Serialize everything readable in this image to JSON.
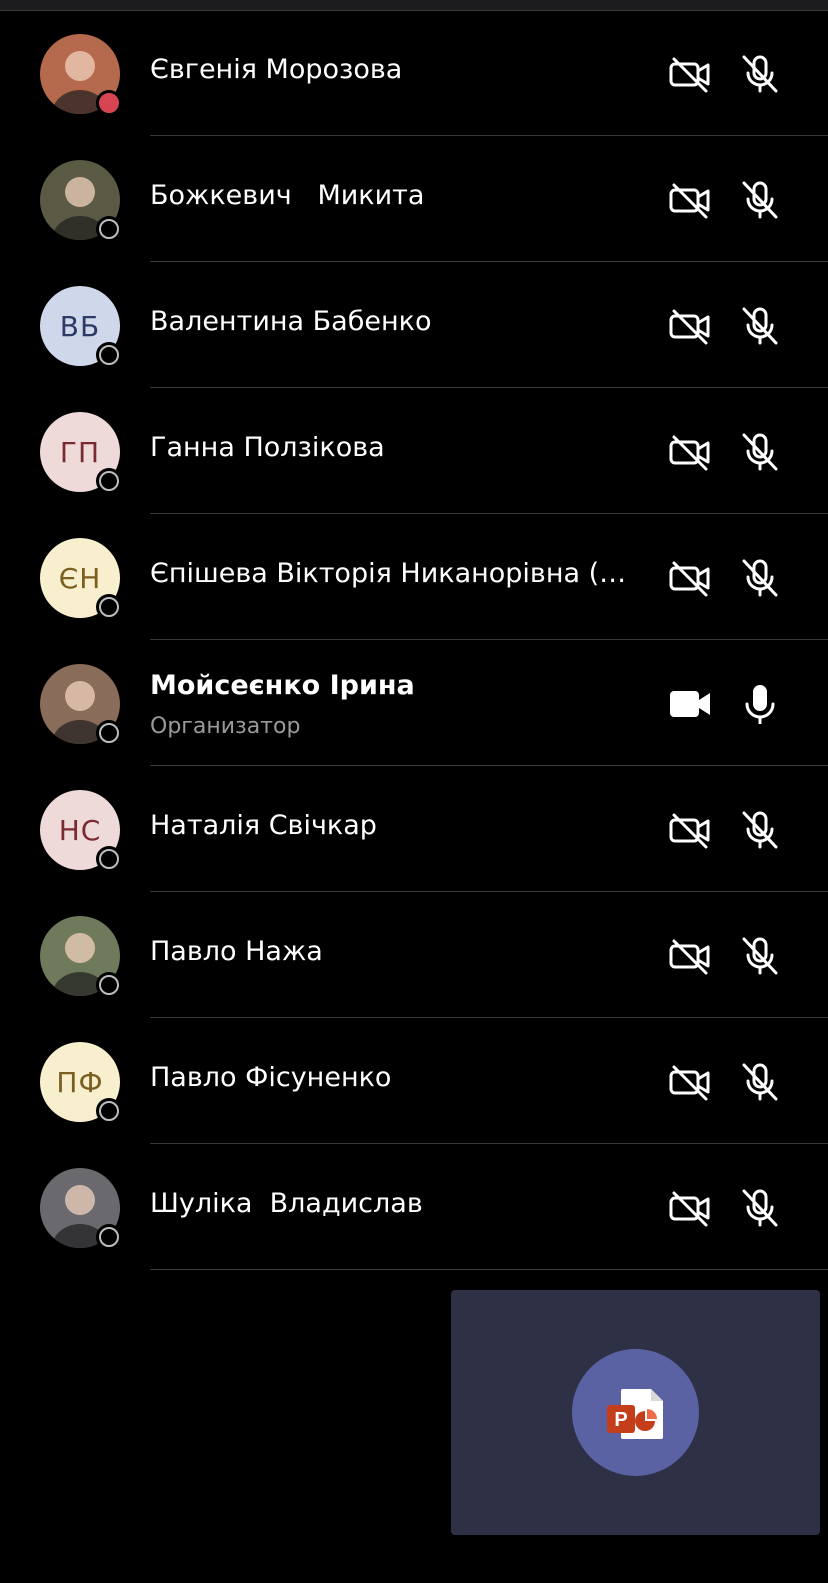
{
  "participants": [
    {
      "name": "Євгенія Морозова",
      "avatar_type": "photo",
      "photo_tone": "#b56a4d",
      "status": "busy"
    },
    {
      "name": "Божкевич   Микита",
      "avatar_type": "photo",
      "photo_tone": "#5b5a45",
      "status": "offline"
    },
    {
      "name": "Валентина Бабенко",
      "avatar_type": "initials",
      "initials": "ВБ",
      "bg": "#cfd8ea",
      "fg": "#2c3b66",
      "status": "offline"
    },
    {
      "name": "Ганна Ползікова",
      "avatar_type": "initials",
      "initials": "ГП",
      "bg": "#efdada",
      "fg": "#7a2b32",
      "status": "offline"
    },
    {
      "name": "Єпішева Вікторія Никанорівна (г...",
      "avatar_type": "initials",
      "initials": "ЄН",
      "bg": "#f7efcd",
      "fg": "#7a5f20",
      "status": "offline"
    },
    {
      "name": "Мойсеєнко Ірина",
      "role": "Организатор",
      "avatar_type": "photo",
      "photo_tone": "#8a6c5a",
      "status": "offline",
      "camera_on": true,
      "mic_on": true
    },
    {
      "name": "Наталія Свічкар",
      "avatar_type": "initials",
      "initials": "НС",
      "bg": "#efdada",
      "fg": "#7a2b32",
      "status": "offline"
    },
    {
      "name": "Павло Нажа",
      "avatar_type": "photo",
      "photo_tone": "#6f7a5c",
      "status": "offline"
    },
    {
      "name": "Павло Фісуненко",
      "avatar_type": "initials",
      "initials": "ПФ",
      "bg": "#f7efcd",
      "fg": "#7a5f20",
      "status": "offline"
    },
    {
      "name": "Шуліка  Владислав",
      "avatar_type": "photo",
      "photo_tone": "#6a6a6e",
      "status": "offline"
    }
  ],
  "colors": {
    "background": "#000000",
    "separator": "#38383a",
    "busy": "#d74553",
    "share_tile": "#2e3046",
    "powerpoint_button": "#5b62a3",
    "powerpoint_brand": "#c43e1c"
  },
  "icons": {
    "camera_off": "camera-off-icon",
    "mic_off": "mic-off-icon",
    "camera_on": "camera-icon",
    "mic_on": "mic-icon",
    "share": "powerpoint-icon"
  }
}
